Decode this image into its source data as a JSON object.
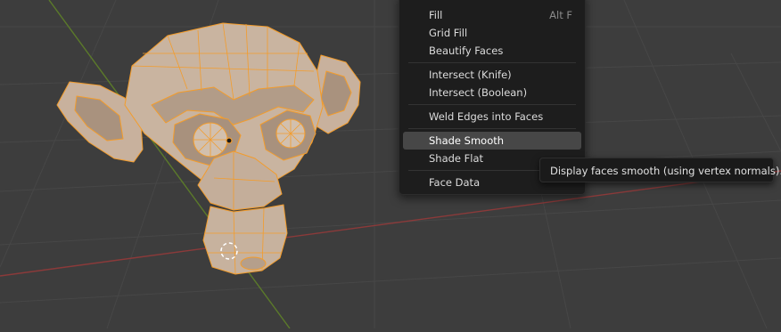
{
  "viewport": {
    "accent_colors": {
      "axis_x": "#8b3a3a",
      "axis_y": "#5b7a2a",
      "selection": "#f39c2b"
    }
  },
  "context_menu": {
    "items": [
      {
        "label": "Fill",
        "shortcut": "Alt F"
      },
      {
        "label": "Grid Fill",
        "shortcut": ""
      },
      {
        "label": "Beautify Faces",
        "shortcut": ""
      },
      {
        "label": "Intersect (Knife)",
        "shortcut": ""
      },
      {
        "label": "Intersect (Boolean)",
        "shortcut": ""
      },
      {
        "label": "Weld Edges into Faces",
        "shortcut": ""
      },
      {
        "label": "Shade Smooth",
        "shortcut": "",
        "highlighted": true
      },
      {
        "label": "Shade Flat",
        "shortcut": ""
      },
      {
        "label": "Face Data",
        "shortcut": "",
        "submenu": true
      }
    ]
  },
  "tooltip": {
    "text": "Display faces smooth (using vertex normals)."
  }
}
